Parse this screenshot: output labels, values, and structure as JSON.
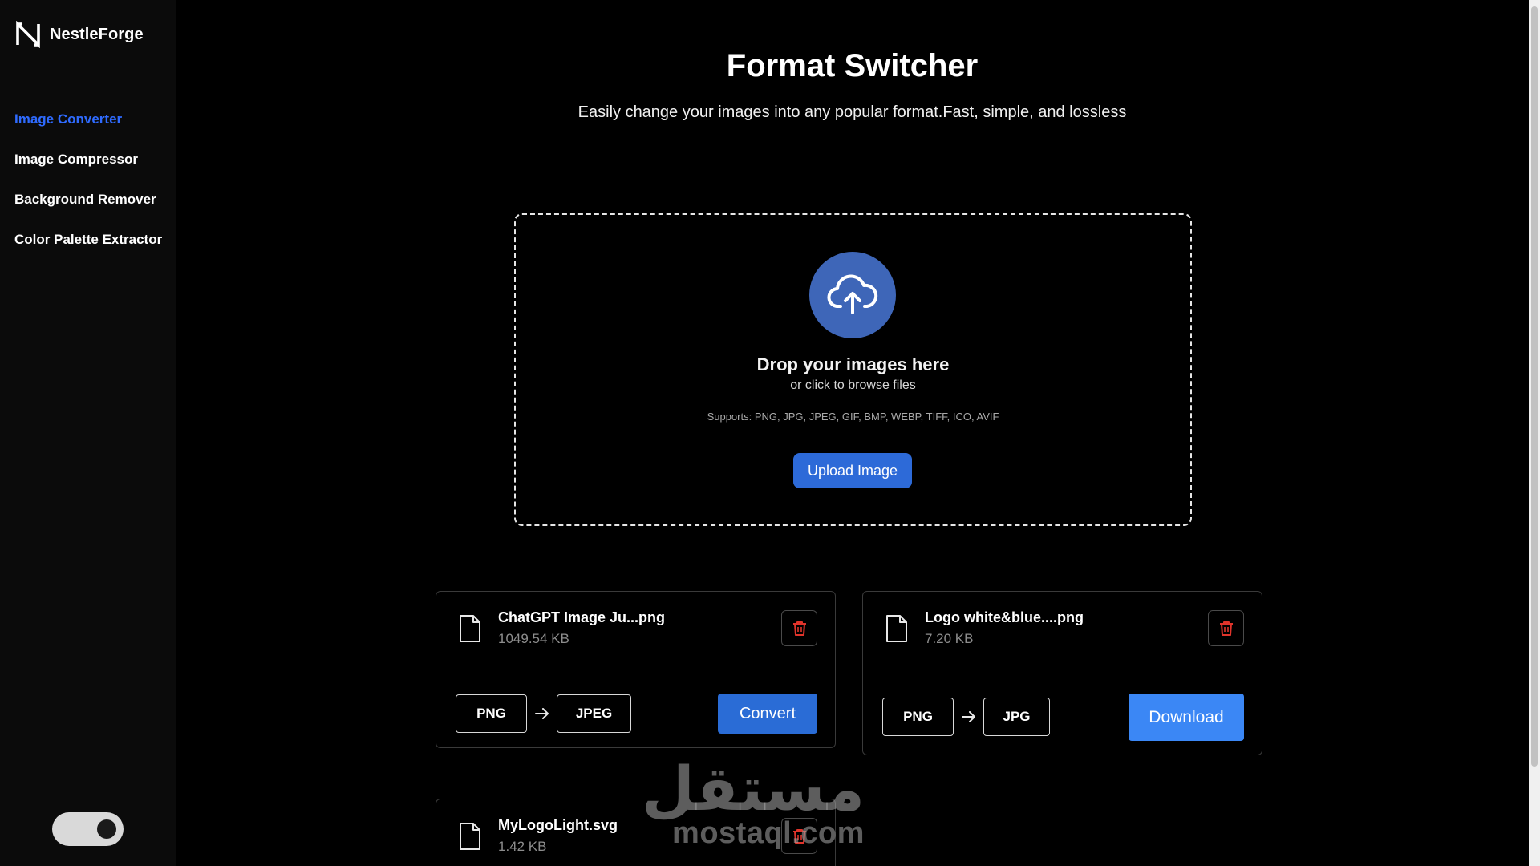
{
  "brand": {
    "name": "NestleForge",
    "logo_icon": "n-logo-icon"
  },
  "sidebar": {
    "items": [
      {
        "label": "Image Converter",
        "active": true
      },
      {
        "label": "Image Compressor",
        "active": false
      },
      {
        "label": "Background Remover",
        "active": false
      },
      {
        "label": "Color Palette Extractor",
        "active": false
      }
    ],
    "theme_toggle": {
      "state": "dark"
    }
  },
  "header": {
    "title": "Format Switcher",
    "subtitle": "Easily change your images into any popular format.Fast, simple, and lossless"
  },
  "dropzone": {
    "icon": "cloud-upload-icon",
    "title": "Drop your images here",
    "subtitle": "or click to browse files",
    "supports": "Supports: PNG, JPG, JPEG, GIF, BMP, WEBP, TIFF, ICO, AVIF",
    "button_label": "Upload Image"
  },
  "files": [
    {
      "name": "ChatGPT Image Ju...png",
      "size": "1049.54 KB",
      "from": "PNG",
      "to": "JPEG",
      "action": "Convert"
    },
    {
      "name": "Logo white&blue....png",
      "size": "7.20 KB",
      "from": "PNG",
      "to": "JPG",
      "action": "Download"
    },
    {
      "name": "MyLogoLight.svg",
      "size": "1.42 KB"
    }
  ],
  "watermark": {
    "arabic": "مستقل",
    "latin": "mostaql.com"
  },
  "colors": {
    "accent": "#2f6bff",
    "upload_circle": "#3e66b8",
    "convert_button": "#2a6cd6",
    "download_button": "#3b87f5",
    "delete_icon": "#e0342b"
  }
}
